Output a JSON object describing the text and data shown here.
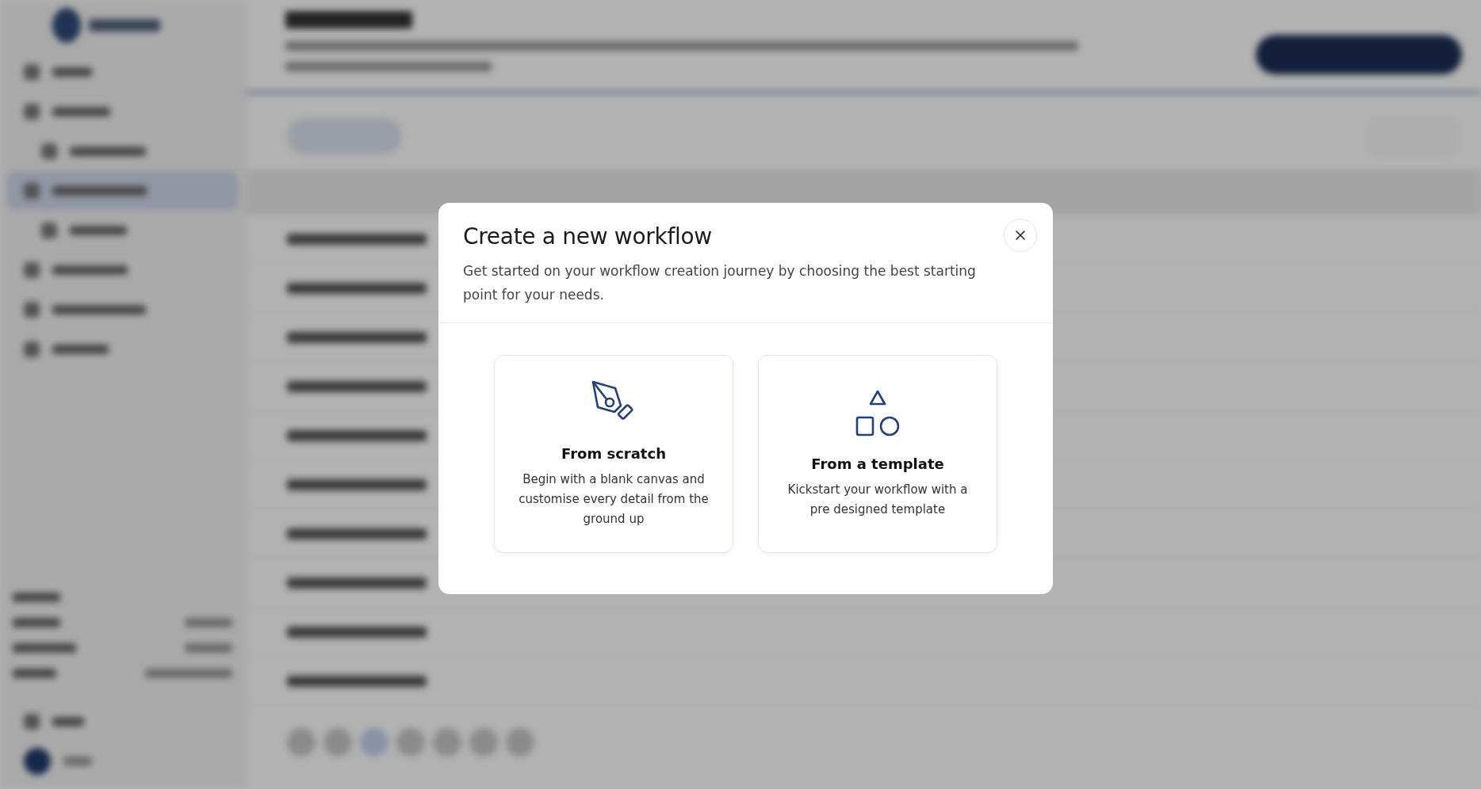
{
  "dialog": {
    "title": "Create a new workflow",
    "description": "Get started on your workflow creation journey by choosing the best starting point for your needs.",
    "options": [
      {
        "kind": "scratch",
        "title": "From scratch",
        "description": "Begin with a blank canvas and customise every detail from the ground up"
      },
      {
        "kind": "template",
        "title": "From a template",
        "description": "Kickstart your workflow with a pre designed template"
      }
    ]
  }
}
